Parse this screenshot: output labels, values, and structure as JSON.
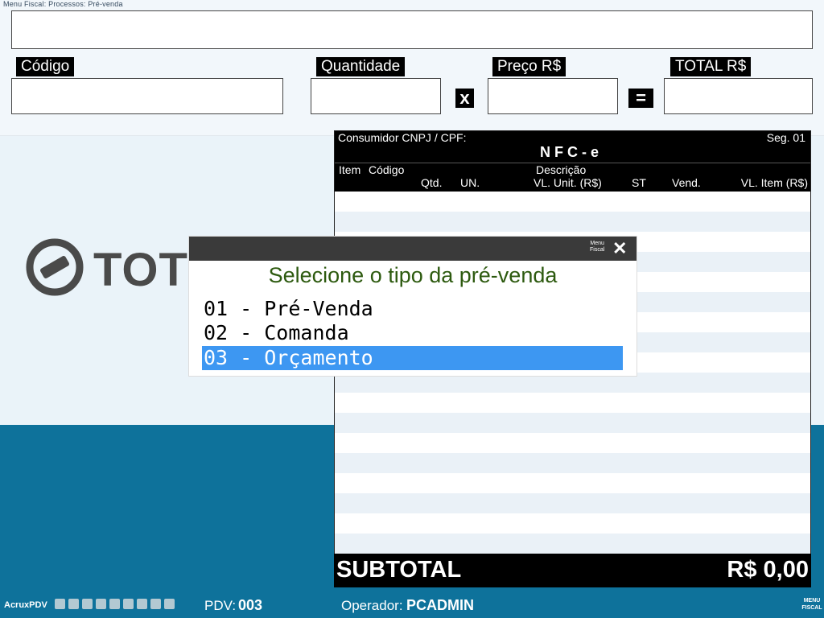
{
  "breadcrumb": "Menu Fiscal: Processos: Pré-venda",
  "fields": {
    "codigo_label": "Código",
    "quantidade_label": "Quantidade",
    "preco_label": "Preço R$",
    "total_label": "TOTAL R$",
    "times_symbol": "x",
    "equals_symbol": "="
  },
  "logo": {
    "text": "TOTVS"
  },
  "nfc": {
    "consumidor_label": "Consumidor CNPJ / CPF:",
    "seg": "Seg. 01",
    "title": "N F C - e",
    "columns_row1": {
      "item": "Item",
      "codigo": "Código",
      "descricao": "Descrição"
    },
    "columns_row2": {
      "qtd": "Qtd.",
      "un": "UN.",
      "vl_unit": "VL. Unit. (R$)",
      "st": "ST",
      "vend": "Vend.",
      "vl_item": "VL. Item (R$)"
    },
    "subtotal_label": "SUBTOTAL",
    "subtotal_value": "R$ 0,00"
  },
  "dialog": {
    "menu_fiscal_line1": "Menu",
    "menu_fiscal_line2": "Fiscal",
    "close_symbol": "✕",
    "title": "Selecione o tipo da pré-venda",
    "options": [
      {
        "label": "01 - Pré-Venda",
        "selected": false
      },
      {
        "label": "02 - Comanda",
        "selected": false
      },
      {
        "label": "03 - Orçamento",
        "selected": true
      }
    ]
  },
  "status": {
    "app_name": "AcruxPDV",
    "pdv_label": "PDV:",
    "pdv_value": "003",
    "operador_label": "Operador:",
    "operador_value": "PCADMIN",
    "menu_line1": "MENU",
    "menu_line2": "FISCAL"
  },
  "colors": {
    "selection": "#3d97f2",
    "bottom_bg": "#0e729b",
    "dialog_title": "#2d5a0f"
  }
}
